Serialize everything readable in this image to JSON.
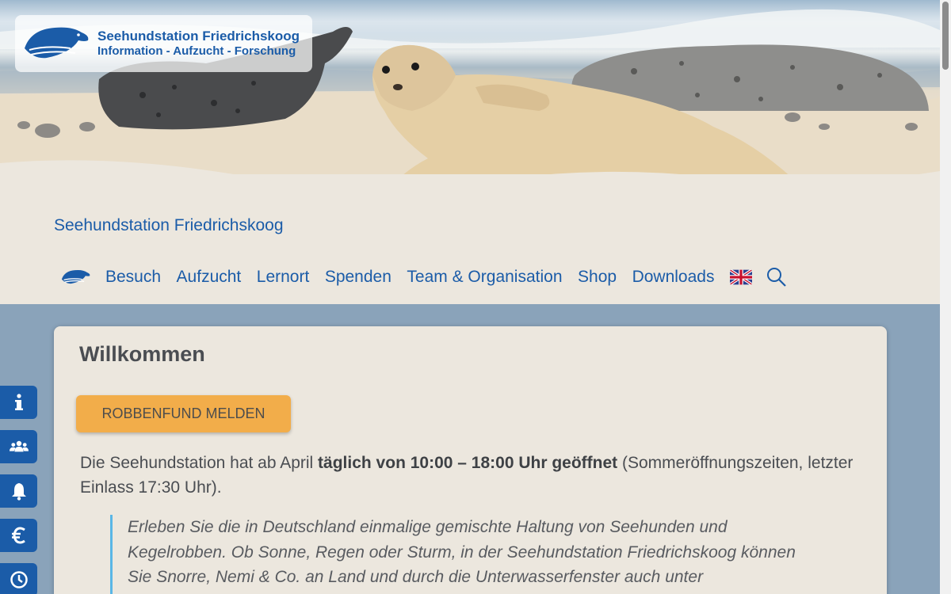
{
  "brand": {
    "title": "Seehundstation Friedrichskoog",
    "subtitle": "Information - Aufzucht - Forschung",
    "logo_icon": "seal-logo-icon",
    "color": "#1b5ca8"
  },
  "header": {
    "site_title": "Seehundstation Friedrichskoog"
  },
  "nav": {
    "items": [
      {
        "label": "Besuch"
      },
      {
        "label": "Aufzucht"
      },
      {
        "label": "Lernort"
      },
      {
        "label": "Spenden"
      },
      {
        "label": "Team & Organisation"
      },
      {
        "label": "Shop"
      },
      {
        "label": "Downloads"
      }
    ],
    "language_icon": "uk-flag-icon",
    "search_icon": "search-icon"
  },
  "main": {
    "heading": "Willkommen",
    "cta_label": "ROBBENFUND MELDEN",
    "intro_pre": "Die Seehundstation hat ab April ",
    "intro_bold": "täglich von 10:00 – 18:00 Uhr geöffnet",
    "intro_post": " (Sommeröffnungszeiten, letzter Einlass 17:30 Uhr).",
    "quote": "Erleben Sie die in Deutschland einmalige gemischte Haltung von Seehunden und Kegelrobben. Ob Sonne, Regen oder Sturm, in der Seehundstation Friedrichskoog können Sie Snorre, Nemi & Co. an Land und durch die Unterwasserfenster auch unter"
  },
  "side_buttons": [
    {
      "icon": "info-icon"
    },
    {
      "icon": "group-icon"
    },
    {
      "icon": "bell-icon"
    },
    {
      "icon": "euro-icon"
    },
    {
      "icon": "clock-icon"
    }
  ],
  "colors": {
    "accent": "#f2ad4a",
    "background": "#8aa3ba",
    "panel": "#ece7de",
    "quote_border": "#5ab7e6"
  }
}
